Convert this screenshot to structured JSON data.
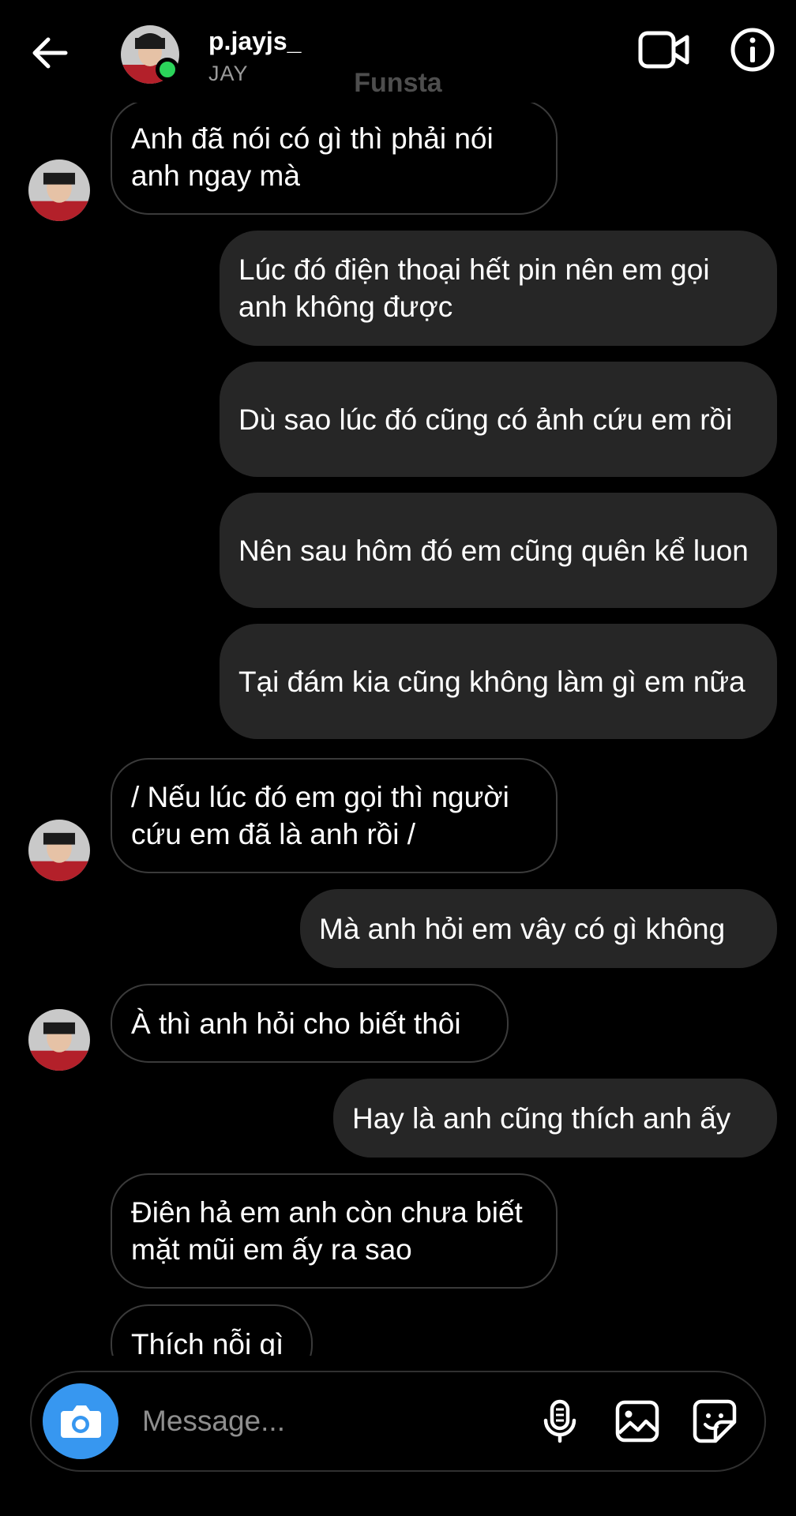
{
  "header": {
    "username": "p.jayjs_",
    "display_name": "JAY",
    "label": "Funsta",
    "icons": {
      "back": "arrow-left-icon",
      "video": "video-call-icon",
      "info": "info-icon"
    },
    "online_color": "#2bd45a"
  },
  "messages": [
    {
      "side": "in",
      "text": "Anh đã nói có gì thì phải nói anh ngay mà"
    },
    {
      "side": "out",
      "text": "Lúc đó điện thoại hết pin nên em gọi anh không được"
    },
    {
      "side": "out",
      "text": "Dù sao lúc đó cũng có ảnh cứu em rồi"
    },
    {
      "side": "out",
      "text": "Nên sau hôm đó em cũng quên kể luon"
    },
    {
      "side": "out",
      "text": "Tại đám kia cũng không làm gì em nữa"
    },
    {
      "side": "in",
      "text": "/ Nếu lúc đó em gọi thì người cứu em đã là anh rồi /"
    },
    {
      "side": "out",
      "text": "Mà anh hỏi em vây có gì không"
    },
    {
      "side": "in",
      "text": "À thì anh hỏi cho biết thôi"
    },
    {
      "side": "out",
      "text": "Hay là anh cũng thích anh ấy"
    },
    {
      "side": "in",
      "text": "Điên hả em anh còn chưa biết mặt mũi em ấy ra sao"
    },
    {
      "side": "in",
      "text": "Thích nỗi gì"
    }
  ],
  "composer": {
    "placeholder": "Message...",
    "camera_color": "#3797f0",
    "icons": [
      "camera-icon",
      "microphone-icon",
      "gallery-icon",
      "sticker-icon"
    ]
  }
}
